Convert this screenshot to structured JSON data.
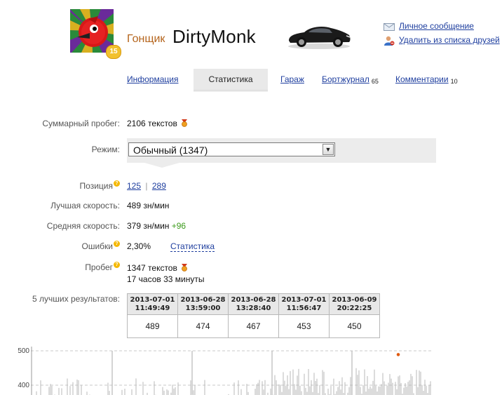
{
  "header": {
    "rank": "Гонщик",
    "name": "DirtyMonk",
    "level": "15",
    "actions": {
      "message": "Личное сообщение",
      "remove_friend": "Удалить из списка друзей"
    }
  },
  "tabs": {
    "info": "Информация",
    "stats": "Статистика",
    "garage": "Гараж",
    "logbook": "Бортжурнал",
    "logbook_count": "65",
    "comments": "Комментарии",
    "comments_count": "10"
  },
  "stats": {
    "total_label": "Суммарный пробег:",
    "total_value": "2106 текстов",
    "mode_label": "Режим:",
    "mode_value": "Обычный (1347)",
    "position_label": "Позиция",
    "position_a": "125",
    "position_sep": "|",
    "position_b": "289",
    "best_label": "Лучшая скорость:",
    "best_value": "489 зн/мин",
    "avg_label": "Средняя скорость:",
    "avg_value": "379 зн/мин",
    "avg_delta": "+96",
    "errors_label": "Ошибки",
    "errors_value": "2,30%",
    "errors_link": "Статистика",
    "mileage_label": "Пробег",
    "mileage_texts": "1347 текстов",
    "mileage_time": "17 часов 33 минуты",
    "top5_label": "5 лучших результатов:"
  },
  "top5": [
    {
      "date": "2013-07-01",
      "time": "11:49:49",
      "value": "489"
    },
    {
      "date": "2013-06-28",
      "time": "13:59:00",
      "value": "474"
    },
    {
      "date": "2013-06-28",
      "time": "13:28:40",
      "value": "467"
    },
    {
      "date": "2013-07-01",
      "time": "11:56:47",
      "value": "453"
    },
    {
      "date": "2013-06-09",
      "time": "20:22:25",
      "value": "450"
    }
  ],
  "chart_data": {
    "type": "line",
    "y_ticks": [
      "500",
      "400"
    ],
    "ylim": [
      370,
      500
    ],
    "series_color": "#b8b8b8",
    "peak_color": "#e05a10",
    "peak_value": 489
  }
}
